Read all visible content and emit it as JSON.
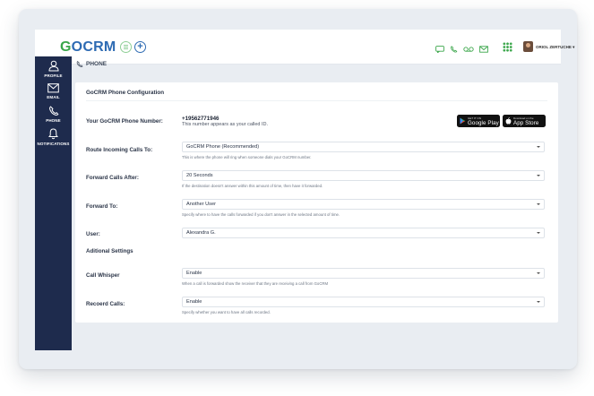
{
  "header": {
    "logo": {
      "part1": "G",
      "part2": "O",
      "part3": "CRM"
    },
    "add_label": "+",
    "user_name": "ORIOL ZERTUCHE ▾",
    "icons": [
      "chat-icon",
      "phone-icon",
      "voicemail-icon",
      "email-icon",
      "apps-grid-icon"
    ]
  },
  "sidebar": {
    "items": [
      {
        "label": "PROFILE",
        "icon": "person-icon"
      },
      {
        "label": "EMAIL",
        "icon": "envelope-icon"
      },
      {
        "label": "PHONE",
        "icon": "phone-icon"
      },
      {
        "label": "NOTIFICATIONS",
        "icon": "bell-icon"
      }
    ]
  },
  "breadcrumb": "PHONE",
  "panel": {
    "title": "GoCRM Phone Configuration",
    "phone_number_label": "Your GoCRM Phone Number:",
    "phone_number": "+19562771946",
    "phone_number_hint": "This number appears as your called ID.",
    "google_play": {
      "small": "GET IT ON",
      "big": "Google Play"
    },
    "app_store": {
      "small": "Download on the",
      "big": "App Store"
    },
    "fields": [
      {
        "label": "Route Incoming Calls To:",
        "value": "GoCRM Phone (Recommended)",
        "hint": "This is where the phone will ring when someone dials your GoCRM number."
      },
      {
        "label": "Forward Calls After:",
        "value": "20 Seconds",
        "hint": "If the destination doesn't answer within this amount of time, then have it forwarded."
      },
      {
        "label": "Forward To:",
        "value": "Another User",
        "hint": "Specify where to have the calls forwarded if you don't answer in the selected amount of time."
      },
      {
        "label": "User:",
        "value": "Alexandra G.",
        "hint": ""
      }
    ],
    "additional_settings": "Aditional Settings",
    "extra_fields": [
      {
        "label": "Call Whisper",
        "value": "Enable",
        "hint": "When a call is forwarded show the receiver that they are receiving a call from GoCRM"
      },
      {
        "label": "Recoerd Calls:",
        "value": "Enable",
        "hint": "Specify whether you want to have all calls recorded."
      }
    ]
  },
  "colors": {
    "sidebar": "#1e2b4d",
    "brand_green": "#3aa64a",
    "brand_blue": "#2e6bb3",
    "background": "#e9edf2"
  }
}
